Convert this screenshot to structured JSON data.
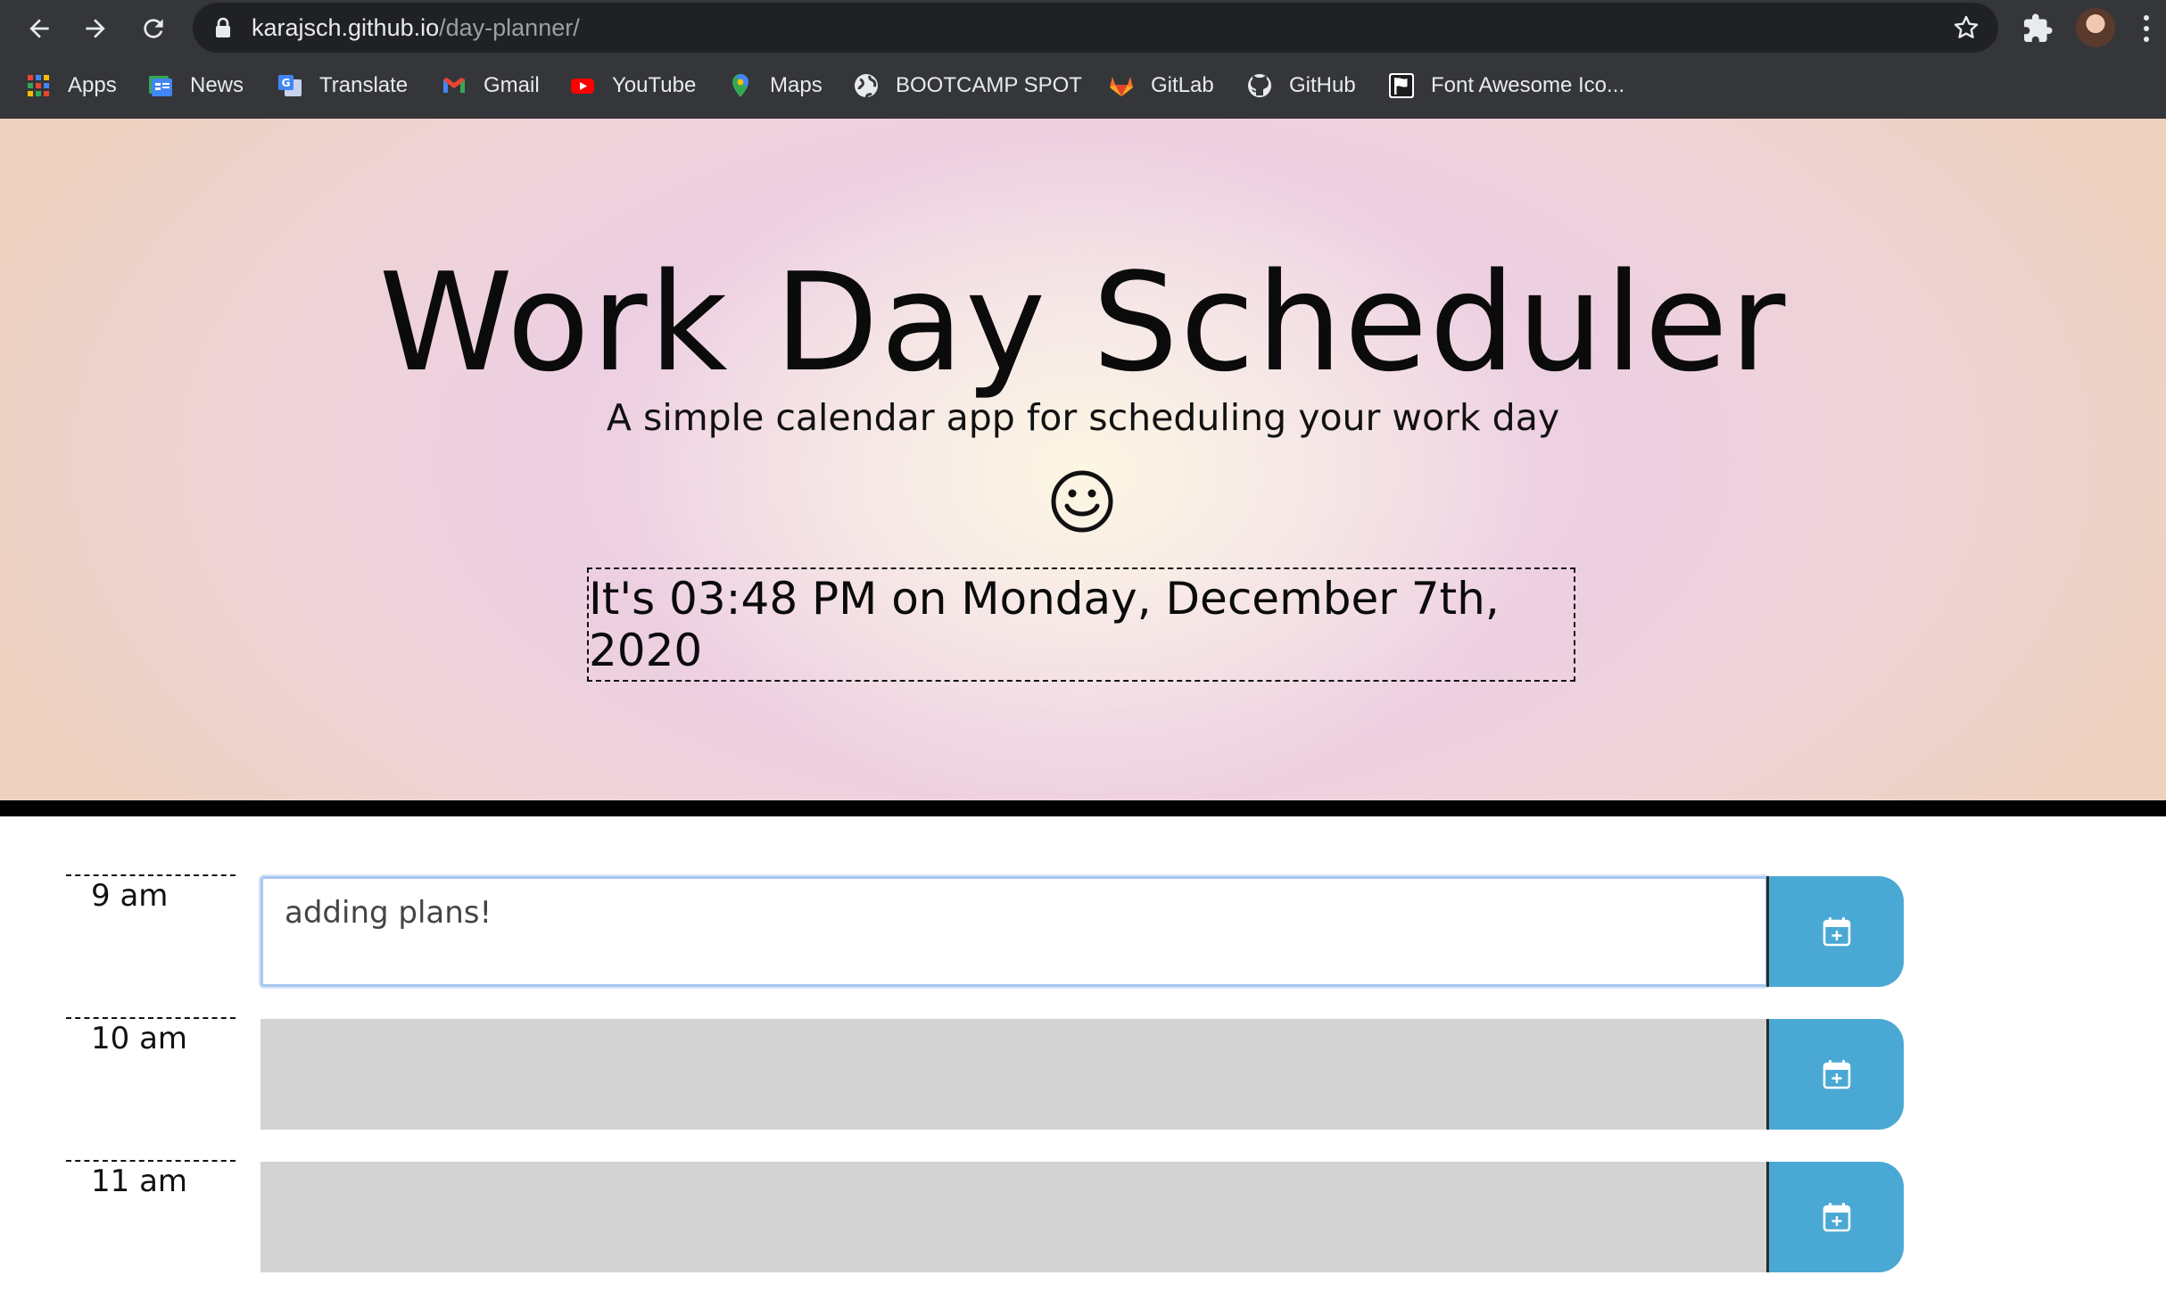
{
  "browser": {
    "url_host": "karajsch.github.io",
    "url_path": "/day-planner/",
    "bookmarks": [
      {
        "label": "Apps",
        "icon": "apps-grid-icon"
      },
      {
        "label": "News",
        "icon": "google-news-icon"
      },
      {
        "label": "Translate",
        "icon": "google-translate-icon"
      },
      {
        "label": "Gmail",
        "icon": "gmail-icon"
      },
      {
        "label": "YouTube",
        "icon": "youtube-icon"
      },
      {
        "label": "Maps",
        "icon": "maps-pin-icon"
      },
      {
        "label": "BOOTCAMP SPOT",
        "icon": "globe-icon"
      },
      {
        "label": "GitLab",
        "icon": "gitlab-icon"
      },
      {
        "label": "GitHub",
        "icon": "github-icon"
      },
      {
        "label": "Font Awesome Ico...",
        "icon": "flag-icon"
      }
    ]
  },
  "header": {
    "title": "Work Day Scheduler",
    "lead": "A simple calendar app for scheduling your work day",
    "smiley_icon": "smiley-face-icon",
    "current_datetime": "It's 03:48 PM on Monday, December 7th, 2020"
  },
  "schedule": {
    "rows": [
      {
        "hour": "9 am",
        "text": "adding plans!",
        "state": "active"
      },
      {
        "hour": "10 am",
        "text": "",
        "state": "past"
      },
      {
        "hour": "11 am",
        "text": "",
        "state": "past"
      }
    ],
    "save_icon": "calendar-plus-icon"
  },
  "colors": {
    "save_button": "#4aa9d4",
    "past_row": "#d3d3d3",
    "chrome_bg": "#35363a"
  }
}
